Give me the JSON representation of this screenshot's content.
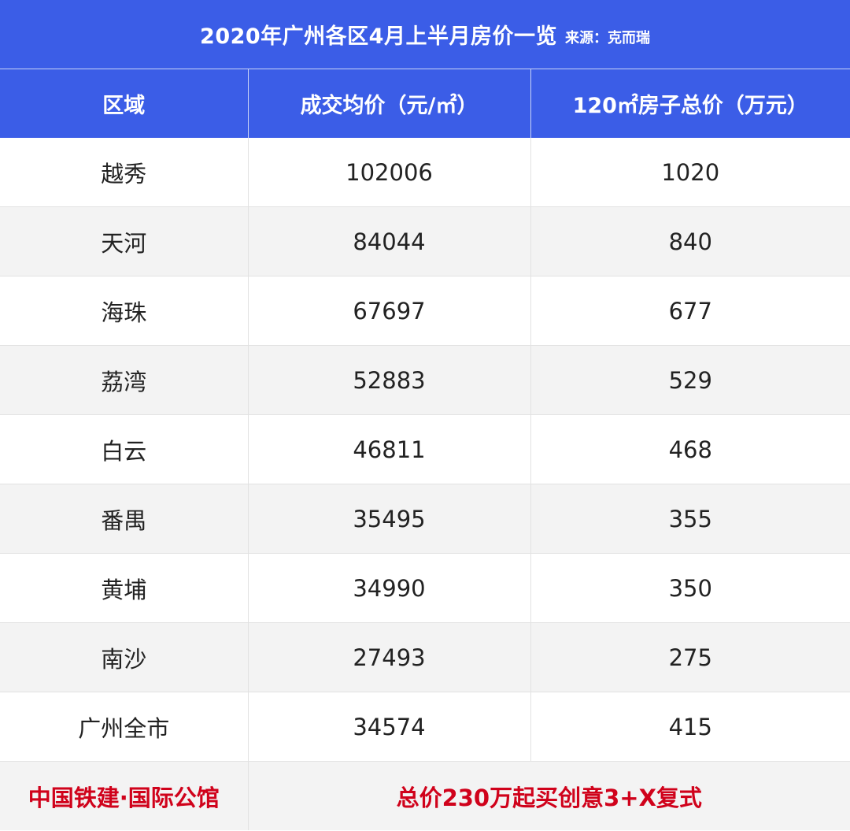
{
  "title": {
    "main": "2020年广州各区4月上半月房价一览",
    "source": "来源：克而瑞"
  },
  "headers": [
    "区域",
    "成交均价（元/㎡）",
    "120㎡房子总价（万元）"
  ],
  "rows": [
    {
      "district": "越秀",
      "avg_price": "102006",
      "total_price": "1020"
    },
    {
      "district": "天河",
      "avg_price": "84044",
      "total_price": "840"
    },
    {
      "district": "海珠",
      "avg_price": "67697",
      "total_price": "677"
    },
    {
      "district": "荔湾",
      "avg_price": "52883",
      "total_price": "529"
    },
    {
      "district": "白云",
      "avg_price": "46811",
      "total_price": "468"
    },
    {
      "district": "番禺",
      "avg_price": "35495",
      "total_price": "355"
    },
    {
      "district": "黄埔",
      "avg_price": "34990",
      "total_price": "350"
    },
    {
      "district": "南沙",
      "avg_price": "27493",
      "total_price": "275"
    },
    {
      "district": "广州全市",
      "avg_price": "34574",
      "total_price": "415"
    }
  ],
  "footer": {
    "left": "中国铁建·国际公馆",
    "right": "总价230万起买创意3+X复式"
  },
  "colors": {
    "header_bg": "#3b5de7",
    "header_text": "#ffffff",
    "row_alt_bg": "#f3f3f3",
    "footer_text": "#d0021b"
  }
}
